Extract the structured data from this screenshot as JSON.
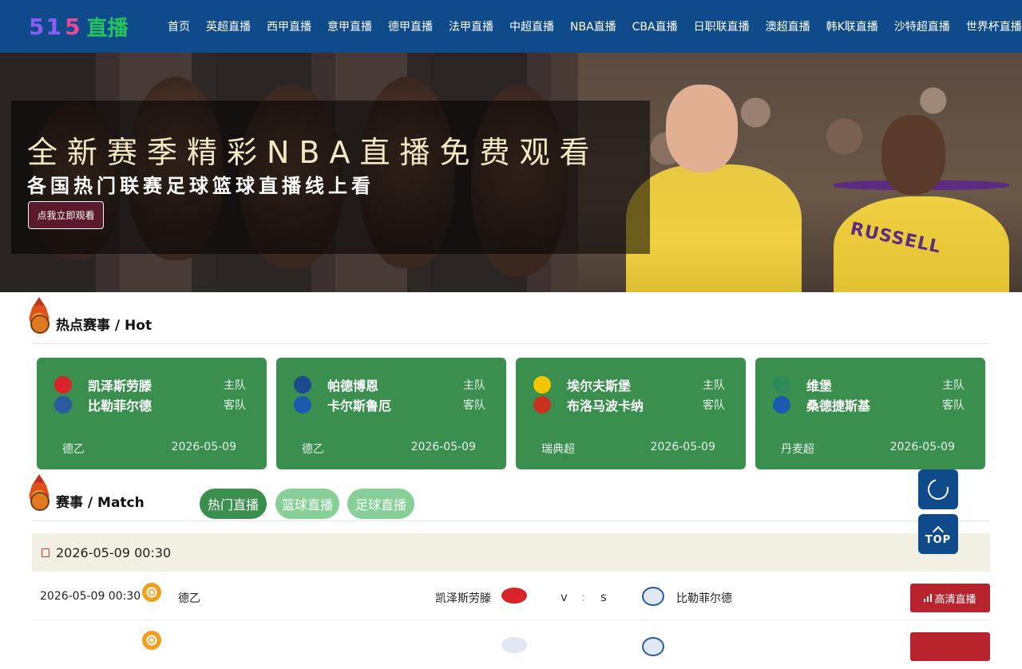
{
  "site": {
    "logo_digits_1": "51",
    "logo_digits_2": "5",
    "logo_text": "直播"
  },
  "nav": [
    "首页",
    "英超直播",
    "西甲直播",
    "意甲直播",
    "德甲直播",
    "法甲直播",
    "中超直播",
    "NBA直播",
    "CBA直播",
    "日职联直播",
    "澳超直播",
    "韩K联直播",
    "沙特超直播",
    "世界杯直播"
  ],
  "banner": {
    "title": "全新赛季精彩NBA直播免费观看",
    "subtitle": "各国热门联赛足球篮球直播线上看",
    "button": "点我立即观看",
    "jersey": "RUSSELL"
  },
  "hot_section": {
    "title": "热点赛事 / Hot"
  },
  "hot_cards": [
    {
      "home": "凯泽斯劳滕",
      "away": "比勒菲尔德",
      "home_role": "主队",
      "away_role": "客队",
      "league": "德乙",
      "date": "2026-05-09",
      "home_color": "#d8232a",
      "away_color": "#2a5aa0"
    },
    {
      "home": "帕德博恩",
      "away": "卡尔斯鲁厄",
      "home_role": "主队",
      "away_role": "客队",
      "league": "德乙",
      "date": "2026-05-09",
      "home_color": "#1a4b8c",
      "away_color": "#1a5bb0"
    },
    {
      "home": "埃尔夫斯堡",
      "away": "布洛马波卡纳",
      "home_role": "主队",
      "away_role": "客队",
      "league": "瑞典超",
      "date": "2026-05-09",
      "home_color": "#f2c500",
      "away_color": "#c8321e"
    },
    {
      "home": "维堡",
      "away": "桑德捷斯基",
      "home_role": "主队",
      "away_role": "客队",
      "league": "丹麦超",
      "date": "2026-05-09",
      "home_color": "#2e8b57",
      "away_color": "#1a5bb0"
    }
  ],
  "match_section": {
    "title": "赛事 / Match"
  },
  "tabs": [
    "热门直播",
    "篮球直播",
    "足球直播"
  ],
  "date_header": "2026-05-09 00:30",
  "matches": [
    {
      "time": "2026-05-09 00:30",
      "league": "德乙",
      "home": "凯泽斯劳滕",
      "score_home": "v",
      "score_away": "s",
      "away": "比勒菲尔德",
      "button": "高清直播"
    },
    {
      "time": "",
      "league": "",
      "home": "",
      "score_home": "",
      "score_away": "",
      "away": "",
      "button": ""
    }
  ],
  "float": {
    "top_label": "TOP"
  },
  "colors": {
    "header": "#0f4a8a",
    "card": "#3a8f4f",
    "tab_inactive": "#86cf96",
    "live_button": "#b8232d"
  }
}
